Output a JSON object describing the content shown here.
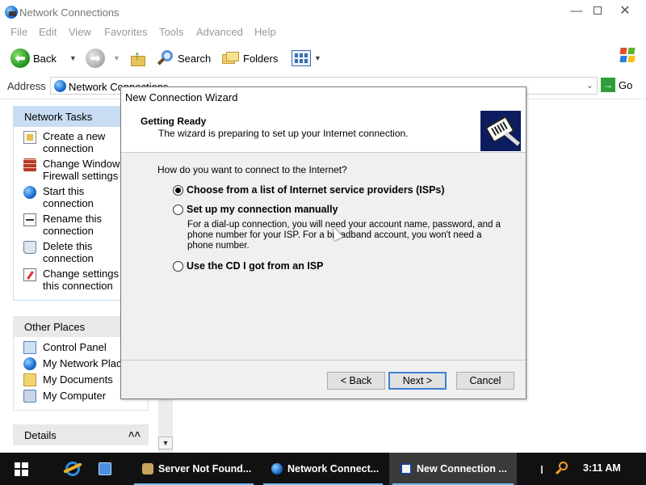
{
  "window": {
    "title": "Network Connections",
    "controls": {
      "minimize": "—",
      "close": "✕"
    }
  },
  "menu": [
    "File",
    "Edit",
    "View",
    "Favorites",
    "Tools",
    "Advanced",
    "Help"
  ],
  "toolbar": {
    "back_label": "Back",
    "search_label": "Search",
    "folders_label": "Folders"
  },
  "address": {
    "label": "Address",
    "value": "Network Connections",
    "go_label": "Go"
  },
  "sidebar": {
    "network_tasks": {
      "title": "Network Tasks",
      "items": [
        {
          "line1": "Create a new",
          "line2": "connection"
        },
        {
          "line1": "Change Windows",
          "line2": "Firewall settings"
        },
        {
          "line1": "Start this",
          "line2": "connection"
        },
        {
          "line1": "Rename this",
          "line2": "connection"
        },
        {
          "line1": "Delete this",
          "line2": "connection"
        },
        {
          "line1": "Change settings of",
          "line2": "this connection"
        }
      ]
    },
    "other_places": {
      "title": "Other Places",
      "items": [
        "Control Panel",
        "My Network Places",
        "My Documents",
        "My Computer"
      ]
    },
    "details": {
      "title": "Details",
      "chevron": "˄˄"
    }
  },
  "dialog": {
    "title": "New Connection Wizard",
    "header_title": "Getting Ready",
    "header_subtitle": "The wizard is preparing to set up your Internet connection.",
    "question": "How do you want to connect to the Internet?",
    "options": [
      {
        "label": "Choose from a list of Internet service providers (ISPs)",
        "checked": true
      },
      {
        "label": "Set up my connection manually",
        "checked": false
      },
      {
        "label": "Use the CD I got from an ISP",
        "checked": false
      }
    ],
    "manual_description": "For a dial-up connection, you will need your account name, password, and a phone number for your ISP. For a broadband account, you won't need a phone number.",
    "buttons": {
      "back": "< Back",
      "next": "Next >",
      "cancel": "Cancel"
    }
  },
  "taskbar": {
    "tasks": [
      {
        "label": "Server Not Found...",
        "icon": "bug-icon"
      },
      {
        "label": "Network Connect...",
        "icon": "globe-icon"
      },
      {
        "label": "New Connection ...",
        "icon": "wizard-icon",
        "active": true
      }
    ],
    "clock": "3:11 AM"
  },
  "colors": {
    "taskbar_bg": "#111111",
    "panel_header_blue": "#c8ddf2",
    "dialog_bg": "#f0f0f0",
    "default_button_border": "#3c7fd3"
  }
}
